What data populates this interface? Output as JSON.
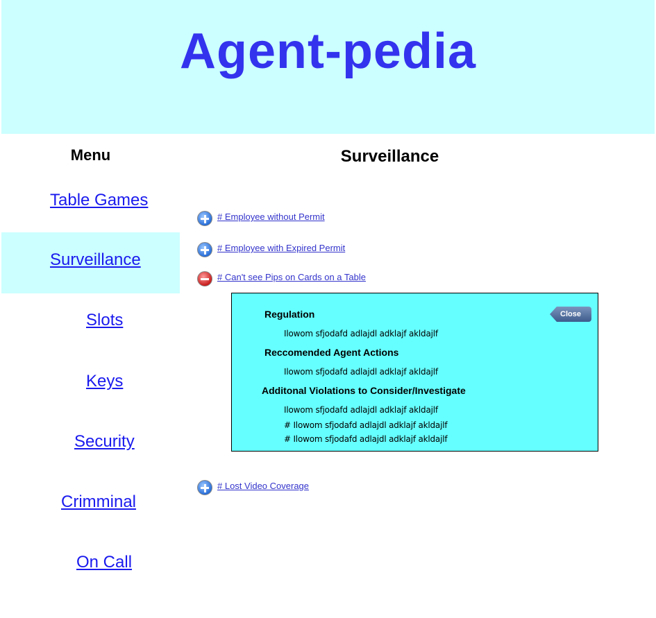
{
  "header": {
    "title": "Agent-pedia"
  },
  "sidebar": {
    "title": "Menu",
    "items": [
      {
        "label": "Table Games"
      },
      {
        "label": "Surveillance"
      },
      {
        "label": "Slots"
      },
      {
        "label": "Keys"
      },
      {
        "label": "Security"
      },
      {
        "label": "Crimminal"
      },
      {
        "label": "On Call"
      }
    ]
  },
  "main": {
    "title": "Surveillance",
    "faq": [
      {
        "label": "# Employee without Permit",
        "expanded": false
      },
      {
        "label": "# Employee with Expired Permit",
        "expanded": false
      },
      {
        "label": "# Can't see Pips on Cards on a Table",
        "expanded": true
      },
      {
        "label": "# Lost Video Coverage",
        "expanded": false
      }
    ],
    "detail": {
      "close_label": "Close",
      "sections": [
        {
          "heading": "Regulation",
          "lines": [
            "Ilowom sfjodafd adlajdl adklajf  akldajlf"
          ]
        },
        {
          "heading": "Reccomended Agent Actions",
          "lines": [
            "Ilowom sfjodafd adlajdl adklajf  akldajlf"
          ]
        },
        {
          "heading": "Additonal Violations to Consider/Investigate",
          "lines": [
            "Ilowom sfjodafd adlajdl adklajf  akldajlf",
            "# Ilowom sfjodafd adlajdl adklajf  akldajlf",
            "# Ilowom sfjodafd adlajdl adklajf  akldajlf"
          ]
        }
      ]
    }
  },
  "colors": {
    "header_bg": "#ccffff",
    "title_blue": "#3333ee",
    "active_menu_bg": "#ccffff",
    "panel_bg": "#66ffff",
    "link_blue": "#1a1aee"
  },
  "icons": {
    "collapsed": "plus-circle-icon",
    "expanded": "minus-circle-icon"
  }
}
